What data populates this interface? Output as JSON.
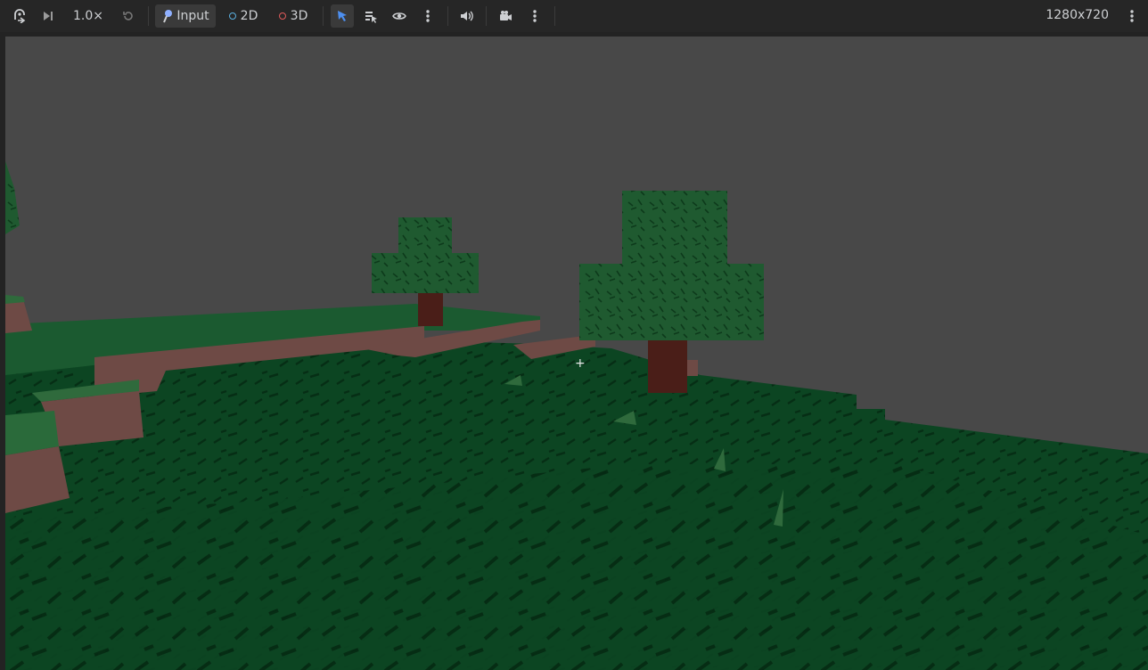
{
  "toolbar": {
    "speed_label": "1.0×",
    "input_label": "Input",
    "mode_2d_label": "2D",
    "mode_3d_label": "3D",
    "resolution": "1280x720"
  },
  "colors": {
    "toolbar_bg": "#262626",
    "sky": "#484848",
    "grass": "#0c4522",
    "grass_dark": "#062e15",
    "dirt": "#6e4a45",
    "leaves": "#1f5a30",
    "trunk": "#4a1e18",
    "accent_blue": "#4d8ff0",
    "dot_2d": "#5bb0e0",
    "dot_3d": "#e05a5a"
  },
  "viewport": {
    "crosshair": "+"
  }
}
